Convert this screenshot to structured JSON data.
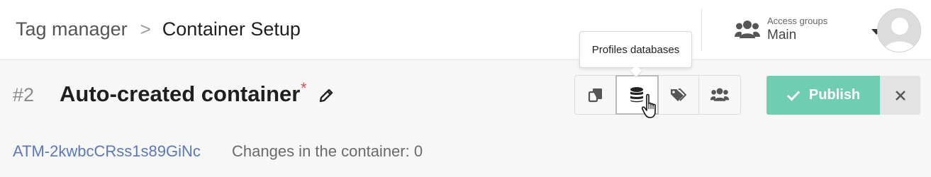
{
  "breadcrumb": {
    "root": "Tag manager",
    "separator": ">",
    "current": "Container Setup"
  },
  "access_groups": {
    "label": "Access groups",
    "value": "Main",
    "icon": "users-icon"
  },
  "avatar": {
    "icon": "user-avatar"
  },
  "container": {
    "id": "#2",
    "name": "Auto-created container",
    "required_mark": "*",
    "code": "ATM-2kwbcCRss1s89GiNc",
    "changes": "Changes in the container: 0"
  },
  "toolbar": {
    "buttons": [
      {
        "icon": "copy-icon",
        "active": false
      },
      {
        "icon": "database-icon",
        "active": true
      },
      {
        "icon": "tags-icon",
        "active": false
      },
      {
        "icon": "users-icon",
        "active": false
      }
    ],
    "tooltip": "Profiles databases"
  },
  "actions": {
    "publish_label": "Publish",
    "close_icon": "close-icon"
  },
  "colors": {
    "publish": "#6fcdb1",
    "link": "#5b79b7",
    "required": "#d9534f"
  }
}
